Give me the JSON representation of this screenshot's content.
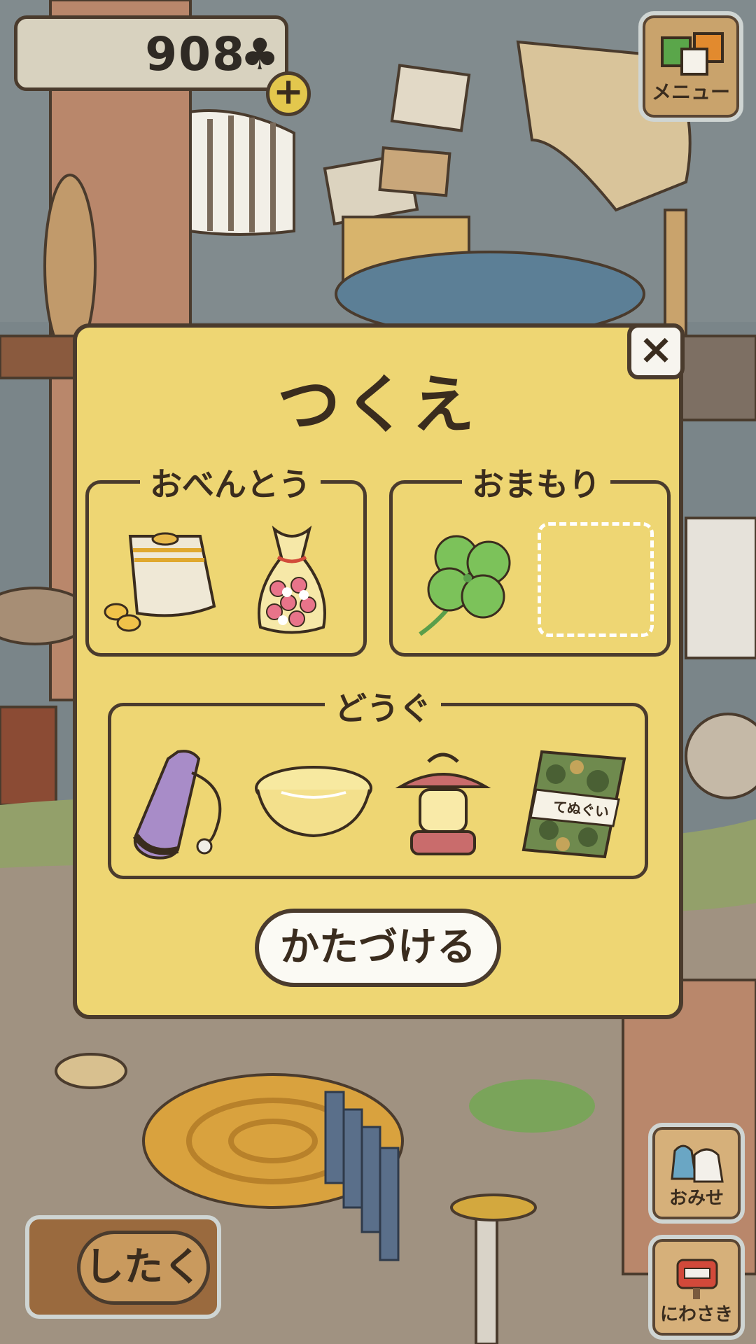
{
  "currency": {
    "count": "908",
    "symbol": "♣",
    "add_label": "+"
  },
  "menu": {
    "label": "メニュー"
  },
  "dialog": {
    "title": "つくえ",
    "close_label": "×",
    "groups": {
      "bento": {
        "label": "おべんとう",
        "items": [
          "bread-bag",
          "flower-candy-bag"
        ]
      },
      "omamori": {
        "label": "おまもり",
        "items": [
          "four-leaf-clover",
          "empty-slot"
        ]
      },
      "dougu": {
        "label": "どうぐ",
        "items": [
          "purple-bottle",
          "glass-bowl",
          "lantern",
          "camo-towel"
        ]
      }
    },
    "towel_label": "てぬぐい",
    "putaway_label": "かたづける"
  },
  "bottom": {
    "shitaku_label": "したく"
  },
  "side": {
    "shop_label": "おみせ",
    "garden_label": "にわさき"
  },
  "colors": {
    "panel": "#eed673",
    "outline": "#4a3b2d",
    "button_white": "#fbfaf4"
  }
}
